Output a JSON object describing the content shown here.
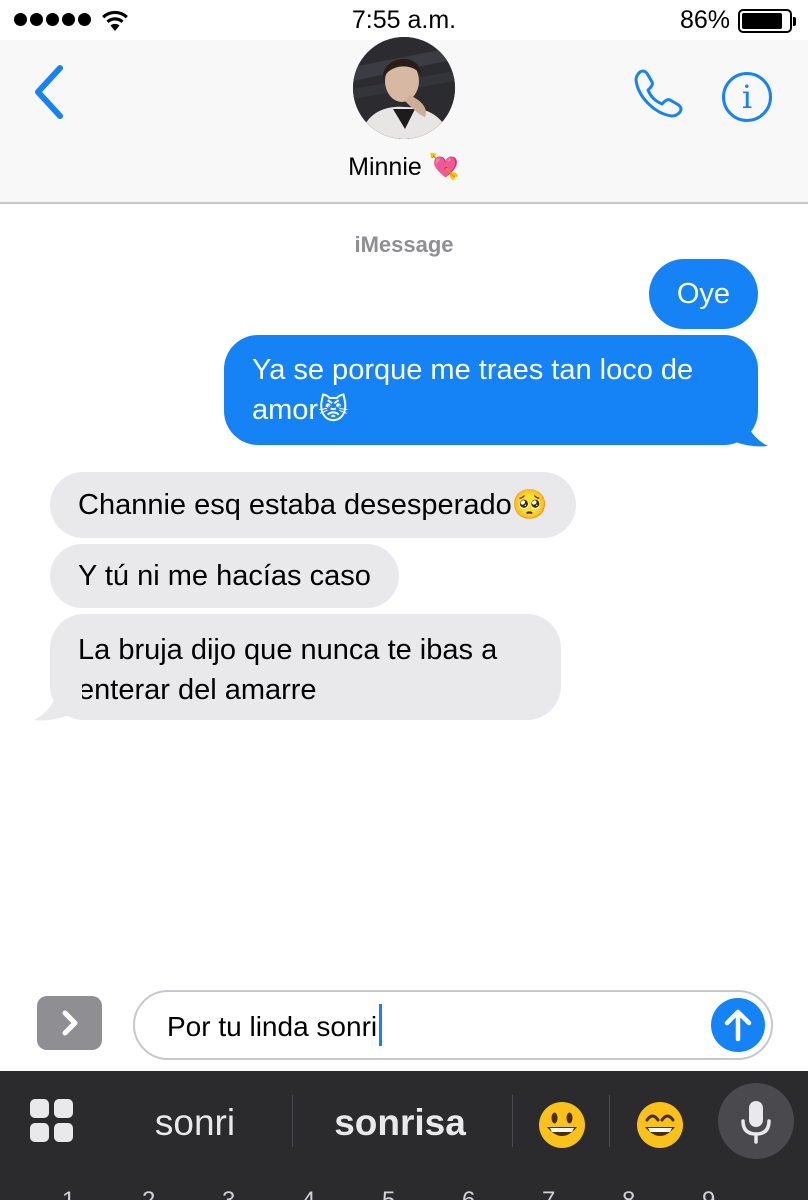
{
  "status_bar": {
    "time": "7:55 a.m.",
    "battery_percent_label": "86%",
    "battery_level": 0.86
  },
  "header": {
    "contact_name": "Minnie 💘"
  },
  "conversation": {
    "service_label": "iMessage",
    "messages": [
      {
        "direction": "outgoing",
        "text": "Oye"
      },
      {
        "direction": "outgoing",
        "text": "Ya se porque me traes tan loco de amor😾"
      },
      {
        "direction": "incoming",
        "text": "Channie esq estaba desesperado🥺"
      },
      {
        "direction": "incoming",
        "text": "Y tú ni me hacías caso"
      },
      {
        "direction": "incoming",
        "text": "La bruja dijo que nunca te ibas a enterar del amarre"
      }
    ]
  },
  "compose": {
    "draft_text": "Por tu linda sonri"
  },
  "keyboard": {
    "suggestions": [
      "sonri",
      "sonrisa"
    ],
    "emoji_suggestions": [
      "grinning-face",
      "grinning-face-smiling-eyes"
    ]
  },
  "colors": {
    "accent": "#1583f6",
    "incoming_bubble": "#e9e9eb",
    "keyboard_background": "#2b2b2d"
  }
}
